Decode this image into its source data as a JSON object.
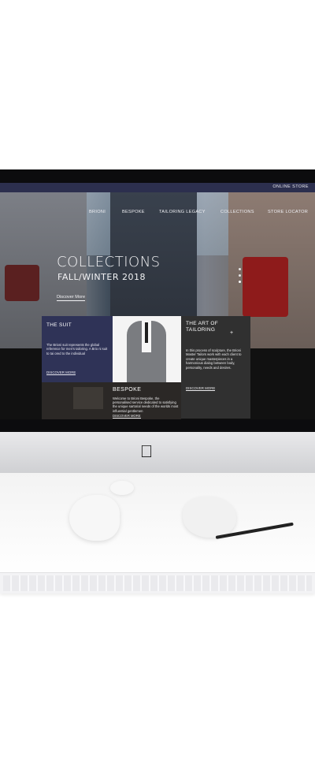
{
  "topbar": {
    "online_store": "ONLINE STORE"
  },
  "nav": {
    "items": [
      "BRIONI",
      "BESPOKE",
      "TAILORING LEGACY",
      "COLLECTIONS",
      "STORE LOCATOR"
    ]
  },
  "hero": {
    "title": "COLLECTIONS",
    "subtitle": "FALL/WINTER 2018",
    "cta": "Discover More"
  },
  "panels": {
    "suit": {
      "title": "THE SUIT",
      "text": "The Brioni suit represents the global reference for men's tailoring. A Brio ni suit to tai ored to the individual",
      "link": "DISCOVER MORE"
    },
    "art": {
      "title": "THE ART OF TAILORING",
      "text": "In this process of sculpture, the Brioni Master Tailors work with each client to create unique masterpieces in a harmonious dialog between body, personality, needs and desires.",
      "link": "DISCOVER MORE"
    },
    "bespoke": {
      "title": "BESPOKE",
      "text": "Welcome to Brioni Bespoke, the personalised service dedicated to satisfying the unique sartorial needs of the worlds most influential gentlemen",
      "link": "DISCOVER MORE"
    }
  },
  "device": {
    "logo": "apple-icon"
  }
}
